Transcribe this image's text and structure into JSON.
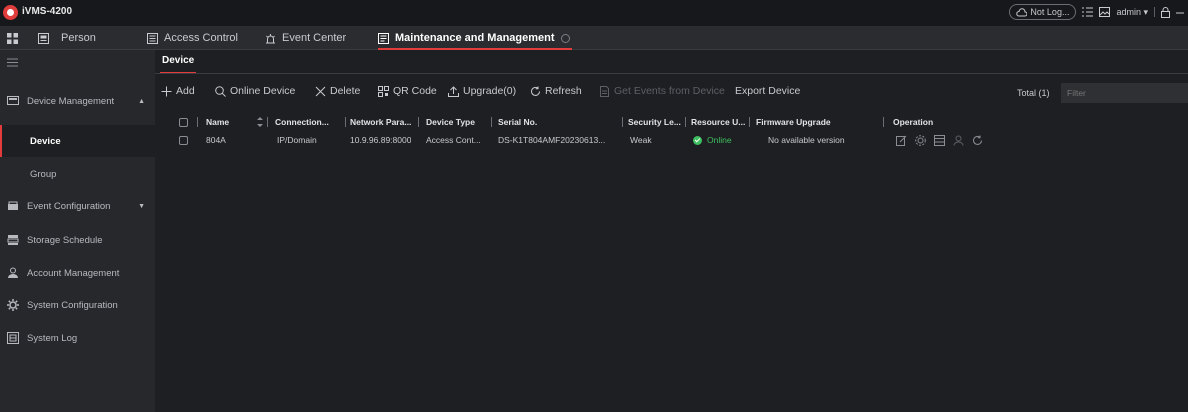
{
  "app": {
    "title": "iVMS-4200",
    "not_logged": "Not Log...",
    "user": "admin",
    "icons": [
      "cloud-icon",
      "list-icon",
      "image-icon",
      "user-caret-icon",
      "lock-icon",
      "minimize-icon"
    ]
  },
  "tabs": [
    {
      "label": "Person",
      "icon": "person-card-icon"
    },
    {
      "label": "Access Control",
      "icon": "access-control-icon"
    },
    {
      "label": "Event Center",
      "icon": "event-center-icon"
    },
    {
      "label": "Maintenance and Management",
      "icon": "maintenance-icon",
      "active": true
    }
  ],
  "sidebar": {
    "items": [
      {
        "label": "Device Management",
        "icon": "device-management-icon",
        "caret": "▲"
      },
      {
        "label": "Device",
        "sub": true,
        "active": true
      },
      {
        "label": "Group",
        "sub": true
      },
      {
        "label": "Event Configuration",
        "icon": "event-configuration-icon",
        "caret": "▼"
      },
      {
        "label": "Storage Schedule",
        "icon": "storage-icon"
      },
      {
        "label": "Account Management",
        "icon": "account-icon"
      },
      {
        "label": "System Configuration",
        "icon": "gear-icon"
      },
      {
        "label": "System Log",
        "icon": "log-icon"
      }
    ]
  },
  "main": {
    "subtab": "Device",
    "toolbar": {
      "add": "Add",
      "online_device": "Online Device",
      "delete": "Delete",
      "qr_code": "QR Code",
      "upgrade": "Upgrade(0)",
      "refresh": "Refresh",
      "get_events": "Get Events from Device",
      "export": "Export Device",
      "total": "Total (1)",
      "filter_placeholder": "Filter"
    },
    "table": {
      "headers": {
        "name": "Name",
        "connection": "Connection...",
        "network": "Network Para...",
        "device_type": "Device Type",
        "serial": "Serial No.",
        "security": "Security Le...",
        "resource": "Resource U...",
        "firmware": "Firmware Upgrade",
        "operation": "Operation"
      },
      "rows": [
        {
          "name": "804A",
          "connection": "IP/Domain",
          "network": "10.9.96.89:8000",
          "device_type": "Access Cont...",
          "serial": "DS-K1T804AMF20230613...",
          "security": "Weak",
          "resource": "Online",
          "firmware": "No available version"
        }
      ]
    }
  },
  "colors": {
    "accent": "#e23d3d",
    "online": "#3fbf5f"
  }
}
